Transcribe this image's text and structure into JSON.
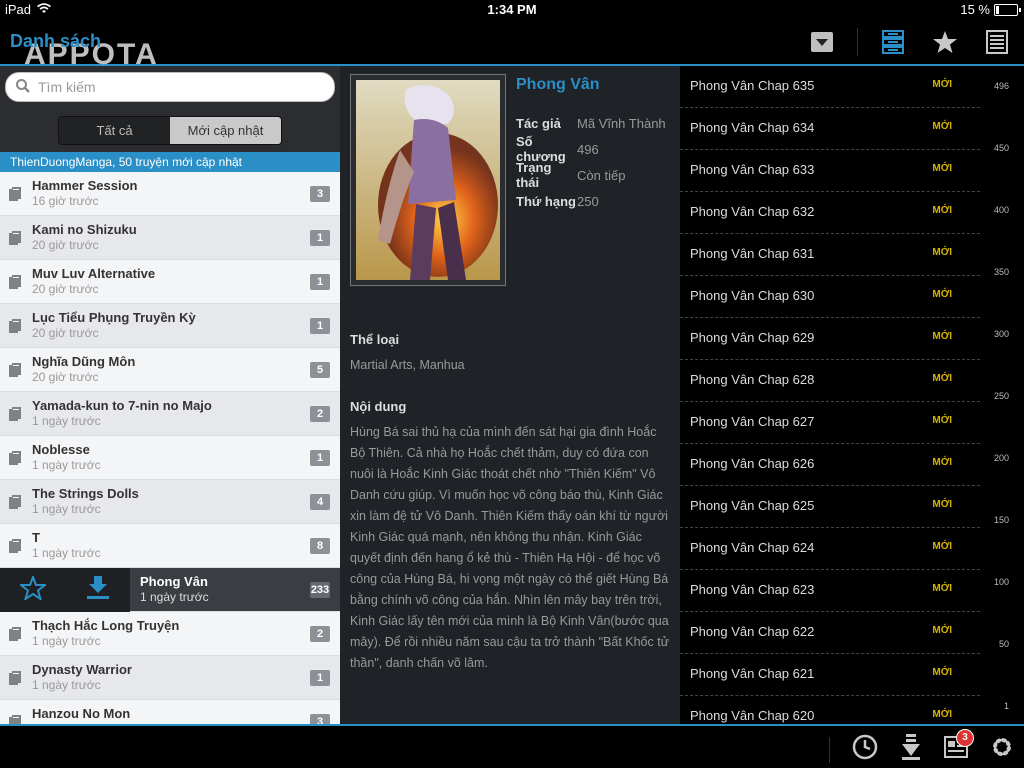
{
  "statusbar": {
    "device": "iPad",
    "time": "1:34 PM",
    "battery": "15 %",
    "battery_level": 0.15
  },
  "topbar": {
    "back_label": "Danh sách",
    "logo_text": "APPOTA",
    "icons": [
      "dropdown-icon",
      "list-view-icon",
      "star-icon",
      "document-list-icon"
    ]
  },
  "search": {
    "placeholder": "Tìm kiếm"
  },
  "segments": {
    "all": "Tất cả",
    "recent": "Mới cập nhật",
    "selected": "recent"
  },
  "notice": "ThienDuongManga, 50 truyện mới cập nhật",
  "manga_list": [
    {
      "title": "Hammer Session",
      "time": "16 giờ trước",
      "count": "3"
    },
    {
      "title": "Kami no Shizuku",
      "time": "20 giờ trước",
      "count": "1"
    },
    {
      "title": "Muv Luv Alternative",
      "time": "20 giờ trước",
      "count": "1"
    },
    {
      "title": "Lục Tiểu Phụng Truyền Kỳ",
      "time": "20 giờ trước",
      "count": "1"
    },
    {
      "title": "Nghĩa Dũng Môn",
      "time": "20 giờ trước",
      "count": "5"
    },
    {
      "title": "Yamada-kun to 7-nin no Majo",
      "time": "1 ngày trước",
      "count": "2"
    },
    {
      "title": "Noblesse",
      "time": "1 ngày trước",
      "count": "1"
    },
    {
      "title": "The Strings Dolls",
      "time": "1 ngày trước",
      "count": "4"
    },
    {
      "title": "T",
      "time": "1 ngày trước",
      "count": "8"
    },
    {
      "title": "Phong Vân",
      "time": "1 ngày trước",
      "count": "233",
      "selected": true
    },
    {
      "title": "Thạch Hắc Long Truyện",
      "time": "1 ngày trước",
      "count": "2"
    },
    {
      "title": "Dynasty Warrior",
      "time": "1 ngày trước",
      "count": "1"
    },
    {
      "title": "Hanzou No Mon",
      "time": "",
      "count": "3"
    }
  ],
  "detail": {
    "title": "Phong Vân",
    "author_label": "Tác giả",
    "author": "Mã Vĩnh Thành",
    "chapters_label": "Số chương",
    "chapters": "496",
    "status_label": "Trạng thái",
    "status": "Còn tiếp",
    "rank_label": "Thứ hạng",
    "rank": "250",
    "genre_label": "Thể loại",
    "genre": "Martial Arts, Manhua",
    "content_label": "Nội dung",
    "content": "Hùng Bá sai thủ hạ của mình đến sát hại gia đình Hoắc Bộ Thiên. Cả nhà họ Hoắc chết thảm, duy có đứa con nuôi là Hoắc Kinh Giác thoát chết nhờ \"Thiên Kiếm\" Vô Danh cứu giúp. Vì muốn học võ công báo thù, Kinh Giác xin làm đệ tử Vô Danh. Thiên Kiếm thấy oán khí từ người Kinh Giác quá mạnh, nên không thu nhận. Kinh Giác quyết định đến hang ổ kẻ thù - Thiên Hạ Hội - để học võ công của Hùng Bá, hi vọng một ngày có thể giết Hùng Bá bằng chính võ công của hắn. Nhìn lên mây bay trên trời, Kinh Giác lấy tên mới của mình là Bộ Kinh Vân(bước qua mây). Để rồi nhiều năm sau cậu ta trở thành \"Bất Khốc tử thần\", danh chấn võ lâm."
  },
  "chapters": [
    {
      "name": "Phong Vân Chap 635",
      "badge": "MỚI"
    },
    {
      "name": "Phong Vân Chap 634",
      "badge": "MỚI"
    },
    {
      "name": "Phong Vân Chap 633",
      "badge": "MỚI"
    },
    {
      "name": "Phong Vân Chap 632",
      "badge": "MỚI"
    },
    {
      "name": "Phong Vân Chap 631",
      "badge": "MỚI"
    },
    {
      "name": "Phong Vân Chap 630",
      "badge": "MỚI"
    },
    {
      "name": "Phong Vân Chap 629",
      "badge": "MỚI"
    },
    {
      "name": "Phong Vân Chap 628",
      "badge": "MỚI"
    },
    {
      "name": "Phong Vân Chap 627",
      "badge": "MỚI"
    },
    {
      "name": "Phong Vân Chap 626",
      "badge": "MỚI"
    },
    {
      "name": "Phong Vân Chap 625",
      "badge": "MỚI"
    },
    {
      "name": "Phong Vân Chap 624",
      "badge": "MỚI"
    },
    {
      "name": "Phong Vân Chap 623",
      "badge": "MỚI"
    },
    {
      "name": "Phong Vân Chap 622",
      "badge": "MỚI"
    },
    {
      "name": "Phong Vân Chap 621",
      "badge": "MỚI"
    },
    {
      "name": "Phong Vân Chap 620",
      "badge": "MỚI"
    }
  ],
  "scale_ticks": [
    "496",
    "450",
    "400",
    "350",
    "300",
    "250",
    "200",
    "150",
    "100",
    "50",
    "1"
  ],
  "bottombar": {
    "icons": [
      "history-icon",
      "download-icon",
      "news-icon",
      "settings-icon"
    ],
    "news_badge": "3"
  },
  "colors": {
    "accent": "#2a8fc6",
    "new_badge": "#d4b400",
    "notification": "#dd3333"
  }
}
